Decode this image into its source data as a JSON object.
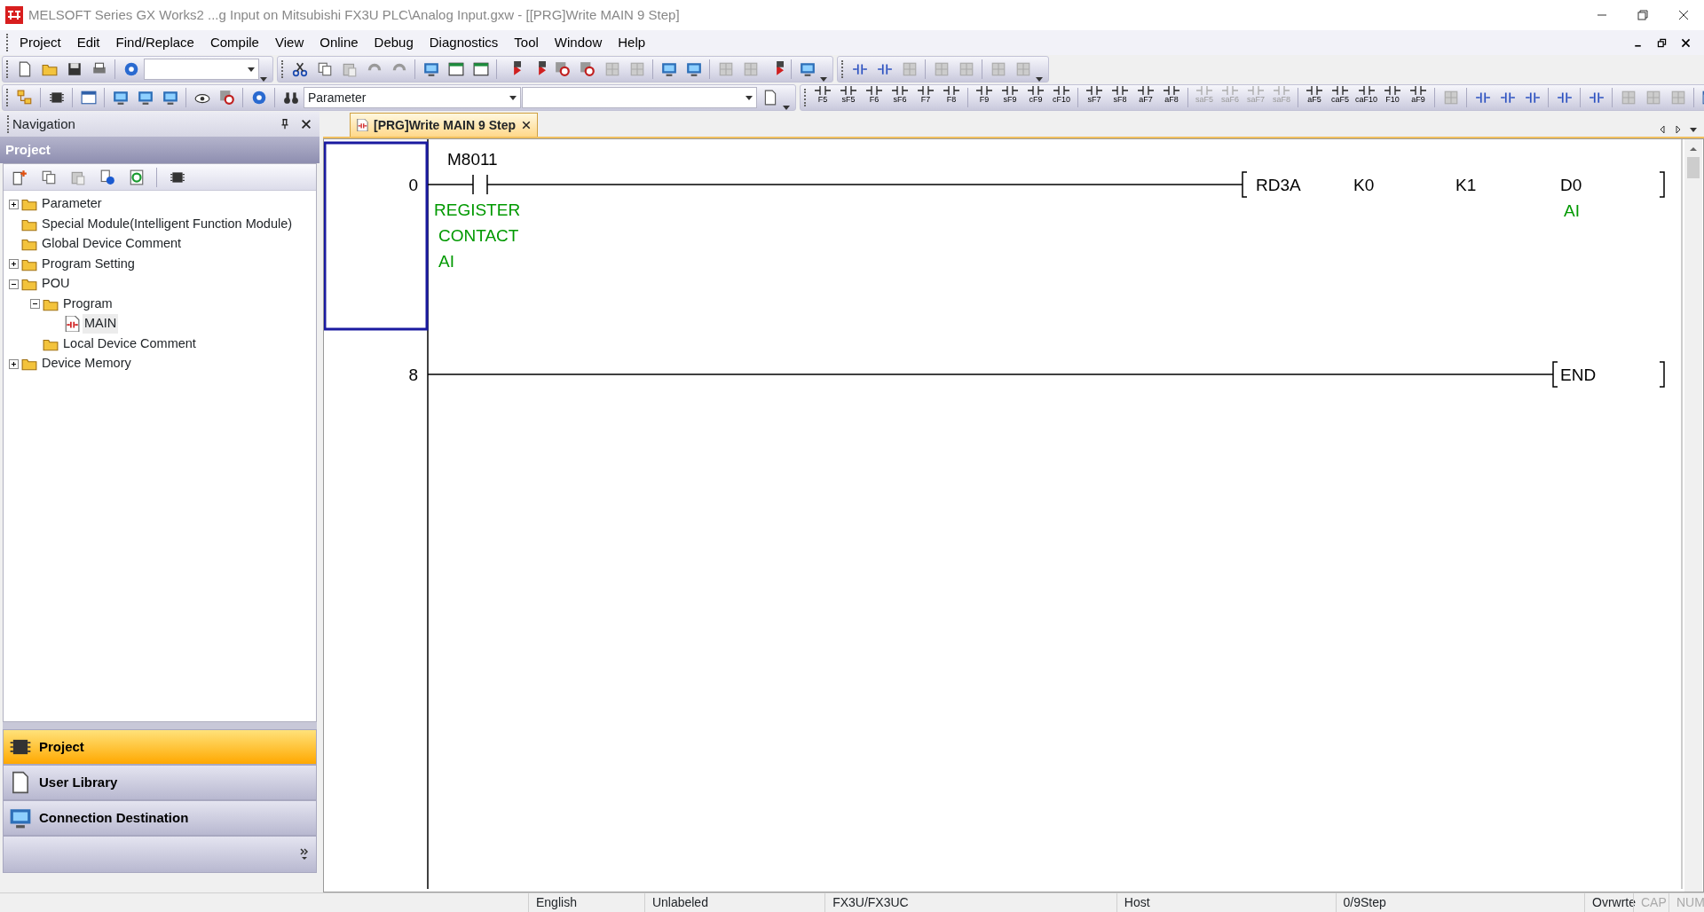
{
  "window": {
    "title": "MELSOFT Series GX Works2 ...g Input on Mitsubishi FX3U PLC\\Analog Input.gxw - [[PRG]Write MAIN 9 Step]"
  },
  "menu": [
    "Project",
    "Edit",
    "Find/Replace",
    "Compile",
    "View",
    "Online",
    "Debug",
    "Diagnostics",
    "Tool",
    "Window",
    "Help"
  ],
  "toolbar": {
    "search_combo": {
      "value": "Parameter"
    }
  },
  "function_key_groups": [
    [
      {
        "label": "F5",
        "disabled": false
      },
      {
        "label": "sF5",
        "disabled": false
      },
      {
        "label": "F6",
        "disabled": false
      },
      {
        "label": "sF6",
        "disabled": false
      },
      {
        "label": "F7",
        "disabled": false
      },
      {
        "label": "F8",
        "disabled": false
      }
    ],
    [
      {
        "label": "F9",
        "disabled": false
      },
      {
        "label": "sF9",
        "disabled": false
      },
      {
        "label": "cF9",
        "disabled": false
      },
      {
        "label": "cF10",
        "disabled": false
      }
    ],
    [
      {
        "label": "sF7",
        "disabled": false
      },
      {
        "label": "sF8",
        "disabled": false
      },
      {
        "label": "aF7",
        "disabled": false
      },
      {
        "label": "aF8",
        "disabled": false
      }
    ],
    [
      {
        "label": "saF5",
        "disabled": true
      },
      {
        "label": "saF6",
        "disabled": true
      },
      {
        "label": "saF7",
        "disabled": true
      },
      {
        "label": "saF8",
        "disabled": true
      }
    ],
    [
      {
        "label": "aF5",
        "disabled": false
      },
      {
        "label": "caF5",
        "disabled": false
      },
      {
        "label": "caF10",
        "disabled": false
      },
      {
        "label": "F10",
        "disabled": false
      },
      {
        "label": "aF9",
        "disabled": false
      }
    ]
  ],
  "navigation": {
    "title": "Navigation",
    "section": "Project",
    "tree": [
      {
        "label": "Parameter",
        "expandable": true,
        "expanded": false,
        "selected": false
      },
      {
        "label": "Special Module(Intelligent Function Module)",
        "expandable": false,
        "selected": false
      },
      {
        "label": "Global Device Comment",
        "expandable": false,
        "selected": false
      },
      {
        "label": "Program Setting",
        "expandable": true,
        "expanded": false,
        "selected": false
      },
      {
        "label": "POU",
        "expandable": true,
        "expanded": true,
        "selected": false,
        "children": [
          {
            "label": "Program",
            "expandable": true,
            "expanded": true,
            "selected": false,
            "children": [
              {
                "label": "MAIN",
                "expandable": false,
                "selected": true
              }
            ]
          },
          {
            "label": "Local Device Comment",
            "expandable": false,
            "selected": false
          }
        ]
      },
      {
        "label": "Device Memory",
        "expandable": true,
        "expanded": false,
        "selected": false
      }
    ],
    "panes": [
      {
        "label": "Project",
        "selected": true
      },
      {
        "label": "User Library",
        "selected": false
      },
      {
        "label": "Connection Destination",
        "selected": false
      }
    ]
  },
  "editor": {
    "tabs": [
      {
        "label": "[PRG]Write MAIN 9 Step",
        "selected": true
      }
    ],
    "rungs": [
      {
        "step": "0",
        "selected": true,
        "contact": {
          "device": "M8011",
          "comment": [
            "REGISTER",
            "CONTACT",
            "AI"
          ]
        },
        "operands": [
          {
            "text": "RD3A"
          },
          {
            "text": "K0"
          },
          {
            "text": "K1"
          },
          {
            "text": "D0",
            "comment": "AI"
          }
        ]
      },
      {
        "step": "8",
        "selected": false,
        "operands": [
          {
            "text": "END"
          }
        ]
      }
    ]
  },
  "status_bar": [
    {
      "text": "English",
      "disabled": false
    },
    {
      "text": "Unlabeled",
      "disabled": false
    },
    {
      "text": "FX3U/FX3UC",
      "disabled": false
    },
    {
      "text": "Host",
      "disabled": false
    },
    {
      "text": "0/9Step",
      "disabled": false
    },
    {
      "text": "Ovrwrte",
      "disabled": false
    },
    {
      "text": "CAP",
      "disabled": true
    },
    {
      "text": "NUM",
      "disabled": true
    }
  ]
}
